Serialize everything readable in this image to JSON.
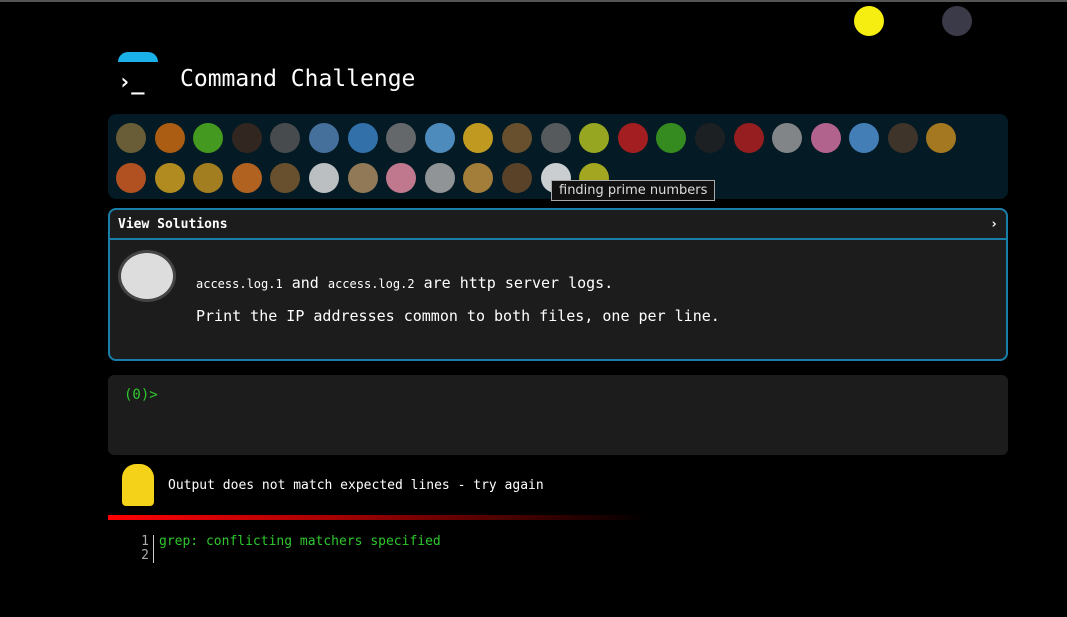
{
  "header": {
    "title": "Command Challenge",
    "logo_prompt": "›_",
    "top_icons": [
      {
        "name": "terminal-icon",
        "color": "#000"
      },
      {
        "name": "shushing-face-icon",
        "color": "#f5ee10"
      },
      {
        "name": "tree-icon",
        "color": "#000"
      },
      {
        "name": "gitlab-icon",
        "color": "#3a3a48"
      },
      {
        "name": "envelope-icon",
        "color": "#000"
      }
    ]
  },
  "animals": {
    "row1": [
      {
        "name": "snail",
        "color": "#7a6a3a"
      },
      {
        "name": "butterfly",
        "color": "#c86a10"
      },
      {
        "name": "caterpillar",
        "color": "#50b020"
      },
      {
        "name": "ant",
        "color": "#3a2a20"
      },
      {
        "name": "spider-web",
        "color": "#555"
      },
      {
        "name": "whale",
        "color": "#5080b0"
      },
      {
        "name": "dolphin",
        "color": "#3a80c0"
      },
      {
        "name": "shark",
        "color": "#777"
      },
      {
        "name": "fish",
        "color": "#5aa0d8"
      },
      {
        "name": "tropical-fish",
        "color": "#e0b020"
      },
      {
        "name": "hedgehog",
        "color": "#7a5a30"
      },
      {
        "name": "wolf",
        "color": "#666"
      },
      {
        "name": "bee",
        "color": "#b0c020"
      },
      {
        "name": "ladybug",
        "color": "#c02020"
      },
      {
        "name": "cricket",
        "color": "#40a020"
      },
      {
        "name": "spider",
        "color": "#222"
      },
      {
        "name": "scorpion",
        "color": "#b02020"
      },
      {
        "name": "fly",
        "color": "#999"
      },
      {
        "name": "worm",
        "color": "#d070a0"
      },
      {
        "name": "microbe",
        "color": "#5090d0"
      },
      {
        "name": "monkey",
        "color": "#4a3a2a"
      },
      {
        "name": "dog",
        "color": "#c08a20"
      }
    ],
    "row2": [
      {
        "name": "fox",
        "color": "#d05a20"
      },
      {
        "name": "cat",
        "color": "#d0a020"
      },
      {
        "name": "lion",
        "color": "#c09020"
      },
      {
        "name": "tiger",
        "color": "#d07020"
      },
      {
        "name": "horse",
        "color": "#7a5a30"
      },
      {
        "name": "unicorn",
        "color": "#ddd"
      },
      {
        "name": "cow",
        "color": "#aa8a60"
      },
      {
        "name": "pig",
        "color": "#e08aa0"
      },
      {
        "name": "mouse",
        "color": "#aaa"
      },
      {
        "name": "hamster",
        "color": "#c09040"
      },
      {
        "name": "bear",
        "color": "#6a4a2a"
      },
      {
        "name": "panda",
        "color": "#eee"
      },
      {
        "name": "chick",
        "color": "#c0c020"
      }
    ]
  },
  "tooltip": "finding prime numbers",
  "challenge": {
    "view_solutions": "View Solutions",
    "chevron": "›",
    "file1": "access.log.1",
    "and": "and",
    "file2": "access.log.2",
    "rest": "are http server logs.",
    "line2": "Print the IP addresses common to both files, one per line."
  },
  "terminal": {
    "prompt": "(0)>"
  },
  "feedback": {
    "message": "Output does not match expected lines - try again"
  },
  "output": {
    "line_numbers": [
      "1",
      "2"
    ],
    "lines": [
      "grep: conflicting matchers specified",
      ""
    ]
  },
  "colors": {
    "accent": "#1a7fa8",
    "prompt_green": "#2ec82e",
    "error_red": "#ff0000"
  }
}
